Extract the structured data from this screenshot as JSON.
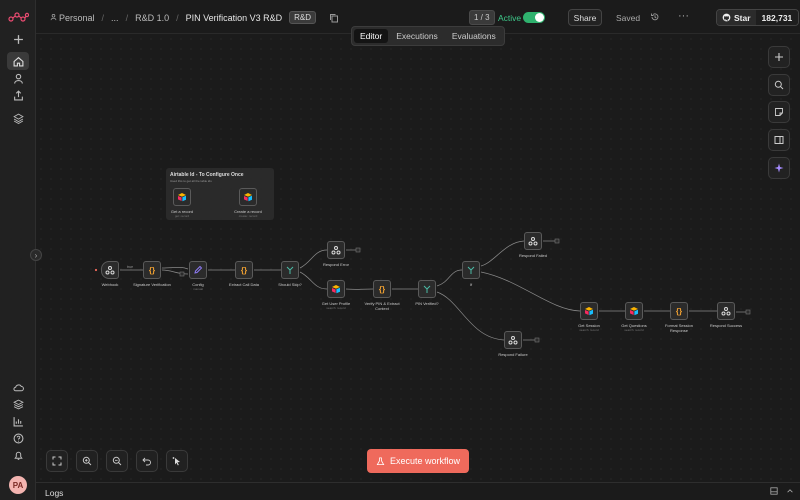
{
  "header": {
    "breadcrumb": {
      "workspace": "Personal",
      "ellipsis": "...",
      "folder": "R&D 1.0",
      "workflow_title": "PIN Verification V3 R&D"
    },
    "tag": "R&D",
    "version": "1 / 3",
    "active_label": "Active",
    "active": true,
    "share_label": "Share",
    "saved_label": "Saved",
    "github": {
      "star_label": "Star",
      "star_count": "182,731"
    }
  },
  "tabs": [
    {
      "label": "Editor",
      "active": true
    },
    {
      "label": "Executions",
      "active": false
    },
    {
      "label": "Evaluations",
      "active": false
    }
  ],
  "sticky": {
    "title": "Airtable Id - To Configure Once",
    "subtitle": "Used this to get all the table ids"
  },
  "nodes": {
    "get_record": {
      "label": "Get a record",
      "sub": "get: record"
    },
    "create_record": {
      "label": "Create a record",
      "sub": "create: record"
    },
    "webhook": {
      "label": "Webhook"
    },
    "signature": {
      "label": "Signature Verification"
    },
    "config": {
      "label": "Config",
      "sub": "manual"
    },
    "extract_call_data": {
      "label": "Extract Call Data"
    },
    "should_skip": {
      "label": "Should Skip?"
    },
    "respond_error": {
      "label": "Respond Error"
    },
    "get_user_profile": {
      "label": "Get User Profile",
      "sub": "search: record"
    },
    "verify_pin": {
      "label": "Verify PIN & Extract Context"
    },
    "pin_verified": {
      "label": "PIN Verified?"
    },
    "if_node": {
      "label": "If"
    },
    "respond_failed": {
      "label": "Respond Failed"
    },
    "respond_failure": {
      "label": "Respond Failure"
    },
    "get_session": {
      "label": "Get Session",
      "sub": "search: record"
    },
    "get_questions": {
      "label": "Get Questions",
      "sub": "search: record"
    },
    "format_session": {
      "label": "Format Session Response"
    },
    "respond_success": {
      "label": "Respond Success"
    }
  },
  "connection_label": "true",
  "execute_label": "Execute workflow",
  "logs_label": "Logs",
  "user_initials": "PA",
  "colors": {
    "accent": "#ef6a5c",
    "active_green": "#3ec98a",
    "airtable_blue": "#2d7ff9"
  }
}
